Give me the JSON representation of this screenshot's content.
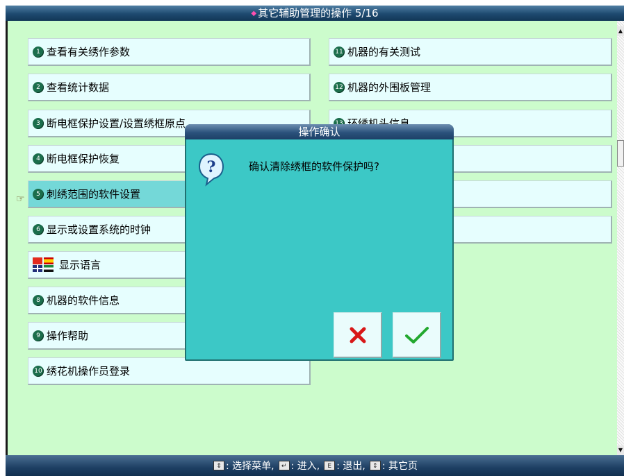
{
  "header": {
    "title": "其它辅助管理的操作 5/16"
  },
  "menu": {
    "left": [
      {
        "num": "1",
        "label": "查看有关绣作参数"
      },
      {
        "num": "2",
        "label": "查看统计数据"
      },
      {
        "num": "3",
        "label": "断电框保护设置/设置绣框原点"
      },
      {
        "num": "4",
        "label": "断电框保护恢复"
      },
      {
        "num": "5",
        "label": "刺绣范围的软件设置"
      },
      {
        "num": "6",
        "label": "显示或设置系统的时钟"
      },
      {
        "num": "",
        "label": "显示语言"
      },
      {
        "num": "8",
        "label": "机器的软件信息"
      },
      {
        "num": "9",
        "label": "操作帮助"
      },
      {
        "num": "10",
        "label": "绣花机操作员登录"
      }
    ],
    "right": [
      {
        "num": "11",
        "label": "机器的有关测试"
      },
      {
        "num": "12",
        "label": "机器的外围板管理"
      },
      {
        "num": "13",
        "label": "环绣机头信息"
      }
    ]
  },
  "dialog": {
    "title": "操作确认",
    "message": "确认清除绣框的软件保护吗?",
    "cancel_icon": "cross-icon",
    "ok_icon": "check-icon"
  },
  "footer": {
    "select_label": ": 选择菜单,",
    "enter_label": ": 进入,",
    "esc_label": ": 退出,",
    "other_label": ": 其它页"
  },
  "colors": {
    "background": "#ccfccc",
    "menu_item": "#e6fefe",
    "menu_item_active": "#74d8d8",
    "dialog": "#3cc8c6",
    "titlebar": "#1e4a70"
  }
}
